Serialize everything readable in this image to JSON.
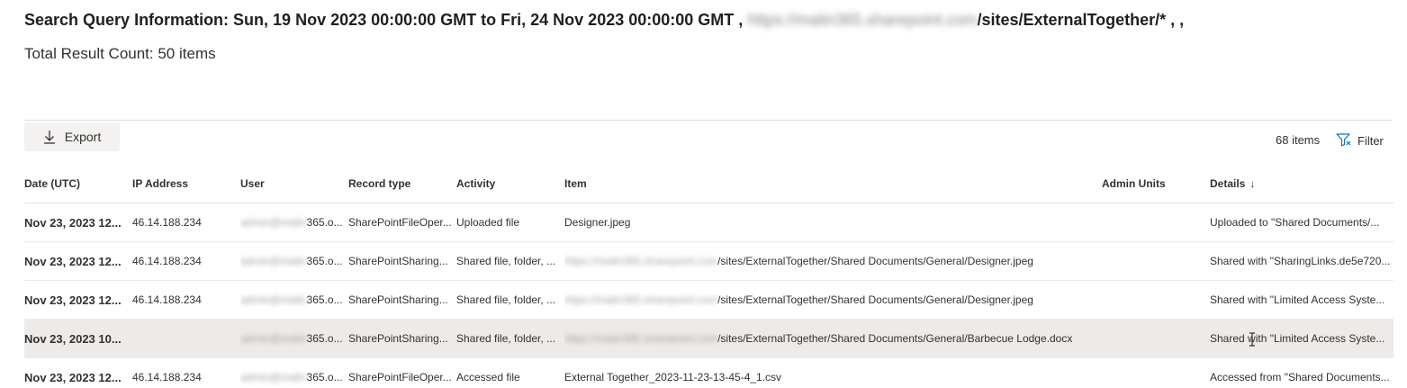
{
  "header": {
    "title_prefix": "Search Query Information: Sun, 19 Nov 2023 00:00:00 GMT to Fri, 24 Nov 2023 00:00:00 GMT ,",
    "title_blurred": "https://malin365.sharepoint.com",
    "title_suffix": "/sites/ExternalTogether/* , ,",
    "total_result": "Total Result Count: 50 items"
  },
  "toolbar": {
    "export_label": "Export",
    "items_count": "68 items",
    "filter_label": "Filter"
  },
  "columns": {
    "date": "Date (UTC)",
    "ip": "IP Address",
    "user": "User",
    "record_type": "Record type",
    "activity": "Activity",
    "item": "Item",
    "admin_units": "Admin Units",
    "details": "Details",
    "details_sort": "↓"
  },
  "rows": [
    {
      "date": "Nov 23, 2023 12...",
      "ip": "46.14.188.234",
      "user_blurred": "admin@malin",
      "user_suffix": "365.o...",
      "record_type": "SharePointFileOper...",
      "activity": "Uploaded file",
      "item_blurred": "",
      "item": "Designer.jpeg",
      "admin_units": "",
      "details": "Uploaded to \"Shared Documents/..."
    },
    {
      "date": "Nov 23, 2023 12...",
      "ip": "46.14.188.234",
      "user_blurred": "admin@malin",
      "user_suffix": "365.o...",
      "record_type": "SharePointSharing...",
      "activity": "Shared file, folder, ...",
      "item_blurred": "https://malin365.sharepoint.com",
      "item": "/sites/ExternalTogether/Shared Documents/General/Designer.jpeg",
      "admin_units": "",
      "details": "Shared with \"SharingLinks.de5e720..."
    },
    {
      "date": "Nov 23, 2023 12...",
      "ip": "46.14.188.234",
      "user_blurred": "admin@malin",
      "user_suffix": "365.o...",
      "record_type": "SharePointSharing...",
      "activity": "Shared file, folder, ...",
      "item_blurred": "https://malin365.sharepoint.com",
      "item": "/sites/ExternalTogether/Shared Documents/General/Designer.jpeg",
      "admin_units": "",
      "details": "Shared with \"Limited Access Syste..."
    },
    {
      "date": "Nov 23, 2023 10...",
      "ip": "",
      "user_blurred": "admin@malin",
      "user_suffix": "365.o...",
      "record_type": "SharePointSharing...",
      "activity": "Shared file, folder, ...",
      "item_blurred": "https://malin365.sharepoint.com",
      "item": "/sites/ExternalTogether/Shared Documents/General/Barbecue Lodge.docx",
      "admin_units": "",
      "details": "Shared with \"Limited Access Syste..."
    },
    {
      "date": "Nov 23, 2023 12...",
      "ip": "46.14.188.234",
      "user_blurred": "admin@malin",
      "user_suffix": "365.o...",
      "record_type": "SharePointFileOper...",
      "activity": "Accessed file",
      "item_blurred": "",
      "item": "External Together_2023-11-23-13-45-4_1.csv",
      "admin_units": "",
      "details": "Accessed from \"Shared Documents..."
    }
  ]
}
